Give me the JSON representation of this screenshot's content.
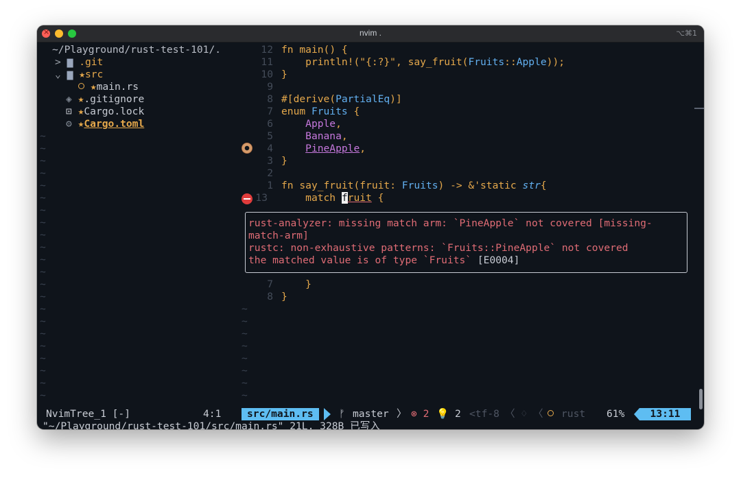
{
  "window": {
    "title": "nvim .",
    "shortcut": "⌥⌘1"
  },
  "tree": {
    "root": "~/Playground/rust-test-101/.",
    "items": [
      {
        "arrow": ">",
        "icon": "▆",
        "star": "",
        "name": ".git"
      },
      {
        "arrow": "⌄",
        "icon": "▆",
        "star": "★",
        "name": "src"
      },
      {
        "arrow": "",
        "icon": "⊛",
        "star": "★",
        "name": "main.rs"
      },
      {
        "arrow": "",
        "icon": "◈",
        "star": "★",
        "name": ".gitignore"
      },
      {
        "arrow": "",
        "icon": "🔓",
        "star": "★",
        "name": "Cargo.lock"
      },
      {
        "arrow": "",
        "icon": "⚙",
        "star": "★",
        "name": "Cargo.toml"
      }
    ],
    "tilde": "~"
  },
  "editor": {
    "line_numbers": [
      "12",
      "11",
      "10",
      "9",
      "8",
      "7",
      "6",
      "5",
      "4",
      "3",
      "2",
      "1",
      "13",
      "7",
      "8"
    ],
    "lines": [
      "fn main() {",
      "    println!(\"{:?}\", say_fruit(Fruits::Apple));",
      "}",
      "",
      "#[derive(PartialEq)]",
      "enum Fruits {",
      "    Apple,",
      "    Banana,",
      "    PineApple,",
      "}",
      "",
      "fn say_fruit(fruit: Fruits) -> &'static str{",
      "    match fruit {",
      "    }",
      "}"
    ],
    "diagnostic": {
      "line1": "rust-analyzer: missing match arm: `PineApple` not covered [missing-",
      "line2": "match-arm]",
      "line3": "rustc: non-exhaustive patterns: `Fruits::PineApple` not covered",
      "line4_red": "the matched value is of type `Fruits` ",
      "line4_code": "[E0004]"
    }
  },
  "statusbar": {
    "left": "NvimTree_1 [-]",
    "left_pos": "4:1",
    "file": "src/main.rs",
    "branch_icon": "ᚠ",
    "branch": "master",
    "errors": "⊗ 2",
    "hints": "💡 2",
    "encoding": "<tf-8",
    "filetype": "rust",
    "percent": "61%",
    "position": "13:11"
  },
  "cmdline": "\"~/Playground/rust-test-101/src/main.rs\" 21L, 328B 已写入",
  "colors": {
    "background": "#0f141b",
    "keyword": "#e5a84b",
    "type": "#62afef",
    "error": "#e06c75",
    "accent": "#5ebdf2"
  }
}
